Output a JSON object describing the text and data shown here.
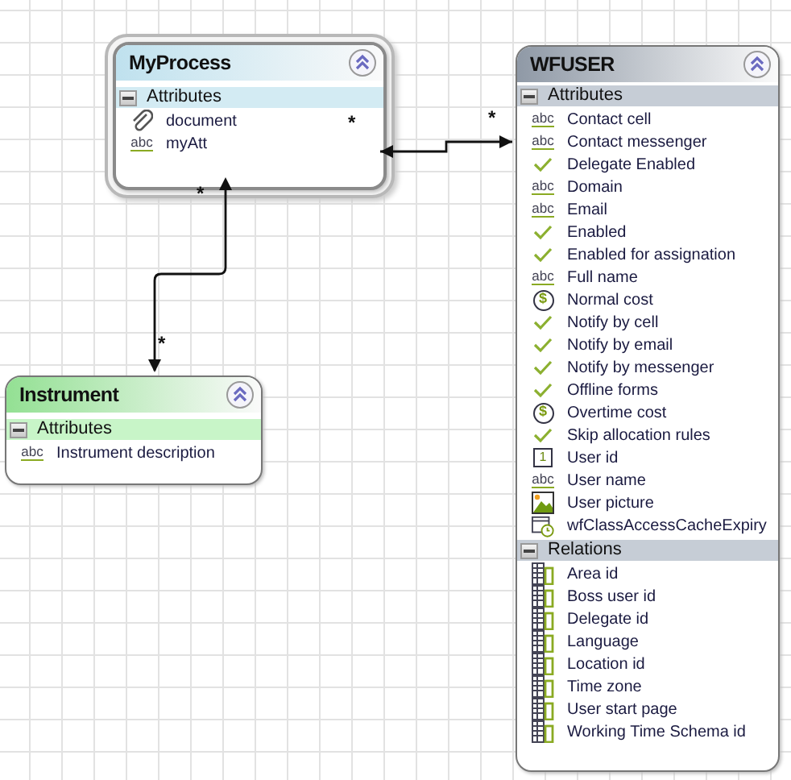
{
  "entities": [
    {
      "title": "MyProcess",
      "color": "#bfe1ee",
      "selected": true,
      "sections": [
        {
          "name": "Attributes",
          "expanded": true,
          "items": [
            {
              "kind": "attachment",
              "label": "document"
            },
            {
              "kind": "text",
              "icon_text": "abc",
              "label": "myAtt"
            }
          ]
        }
      ]
    },
    {
      "title": "Instrument",
      "color": "#93e093",
      "selected": false,
      "sections": [
        {
          "name": "Attributes",
          "expanded": true,
          "items": [
            {
              "kind": "text",
              "icon_text": "abc",
              "label": "Instrument description"
            }
          ]
        }
      ]
    },
    {
      "title": "WFUSER",
      "color": "#8f99a6",
      "selected": false,
      "sections": [
        {
          "name": "Attributes",
          "expanded": true,
          "items": [
            {
              "kind": "text",
              "icon_text": "abc",
              "label": "Contact cell"
            },
            {
              "kind": "text",
              "icon_text": "abc",
              "label": "Contact messenger"
            },
            {
              "kind": "boolean",
              "label": "Delegate Enabled"
            },
            {
              "kind": "text",
              "icon_text": "abc",
              "label": "Domain"
            },
            {
              "kind": "text",
              "icon_text": "abc",
              "label": "Email"
            },
            {
              "kind": "boolean",
              "label": "Enabled"
            },
            {
              "kind": "boolean",
              "label": "Enabled for assignation"
            },
            {
              "kind": "text",
              "icon_text": "abc",
              "label": "Full name"
            },
            {
              "kind": "money",
              "icon_text": "$",
              "label": "Normal cost"
            },
            {
              "kind": "boolean",
              "label": "Notify by cell"
            },
            {
              "kind": "boolean",
              "label": "Notify by email"
            },
            {
              "kind": "boolean",
              "label": "Notify by messenger"
            },
            {
              "kind": "boolean",
              "label": "Offline forms"
            },
            {
              "kind": "money",
              "icon_text": "$",
              "label": "Overtime cost"
            },
            {
              "kind": "boolean",
              "label": "Skip allocation rules"
            },
            {
              "kind": "number",
              "icon_text": "1",
              "label": "User id"
            },
            {
              "kind": "text",
              "icon_text": "abc",
              "label": "User name"
            },
            {
              "kind": "image",
              "label": "User picture"
            },
            {
              "kind": "datetime",
              "label": "wfClassAccessCacheExpiry"
            }
          ]
        },
        {
          "name": "Relations",
          "expanded": true,
          "items": [
            {
              "kind": "relation",
              "label": "Area id"
            },
            {
              "kind": "relation",
              "label": "Boss user id"
            },
            {
              "kind": "relation",
              "label": "Delegate id"
            },
            {
              "kind": "relation",
              "label": "Language"
            },
            {
              "kind": "relation",
              "label": "Location id"
            },
            {
              "kind": "relation",
              "label": "Time zone"
            },
            {
              "kind": "relation",
              "label": "User start page"
            },
            {
              "kind": "relation",
              "label": "Working Time Schema id"
            }
          ]
        }
      ]
    }
  ],
  "connectors": [
    {
      "source_multiplicity": "*",
      "target_multiplicity": "*"
    },
    {
      "source_multiplicity": "*",
      "target_multiplicity": "*"
    }
  ]
}
